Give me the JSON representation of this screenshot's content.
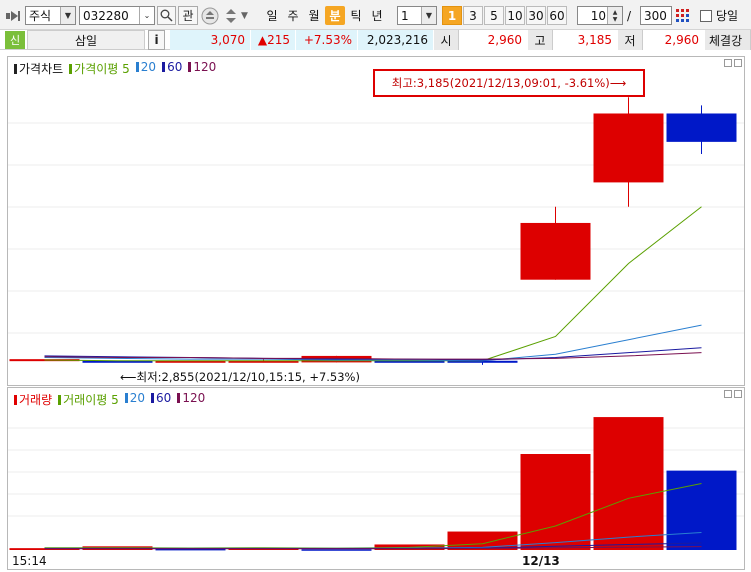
{
  "toolbar": {
    "market": "주식",
    "code": "032280",
    "interest_label": "관",
    "periods": [
      "일",
      "주",
      "월",
      "분",
      "틱",
      "년"
    ],
    "active_period": "분",
    "interval_value": "1",
    "quick_buttons": [
      "1",
      "3",
      "5",
      "10",
      "30",
      "60"
    ],
    "active_quick": "1",
    "count_value": "10",
    "count_sep": "/",
    "count_total": "300",
    "today_label": "당일"
  },
  "info": {
    "badge": "신",
    "name": "삼일",
    "info_button": "i",
    "price": "3,070",
    "change": "▲215",
    "change_pct": "+7.53%",
    "volume": "2,023,216",
    "open_label": "시",
    "open": "2,960",
    "high_label": "고",
    "high": "3,185",
    "low_label": "저",
    "low": "2,960",
    "trade_label": "체결강"
  },
  "price_chart": {
    "legend": [
      {
        "label": "가격차트",
        "color": "#222222"
      },
      {
        "label": "가격이평 5",
        "color": "#5aa000"
      },
      {
        "label": "20",
        "color": "#2a7fd0"
      },
      {
        "label": "60",
        "color": "#1a1aa0"
      },
      {
        "label": "120",
        "color": "#7a1050"
      }
    ],
    "high_annotation": "최고:3,185(2021/12/13,09:01, -3.61%)⟶",
    "low_annotation": "⟵최저:2,855(2021/12/10,15:15, +7.53%)"
  },
  "volume_chart": {
    "legend": [
      {
        "label": "거래량",
        "color": "#e00000"
      },
      {
        "label": "거래이평 5",
        "color": "#5aa000"
      },
      {
        "label": "20",
        "color": "#2a7fd0"
      },
      {
        "label": "60",
        "color": "#1a1aa0"
      },
      {
        "label": "120",
        "color": "#7a1050"
      }
    ]
  },
  "x_axis": {
    "left_label": "15:14",
    "date_label": "12/13"
  },
  "colors": {
    "up": "#dd0000",
    "down": "#0018c8",
    "ma5": "#5aa000",
    "ma20": "#2a7fd0",
    "ma60": "#1a1aa0",
    "ma120": "#7a1050",
    "annotation_box": "#dd0000"
  },
  "chart_data": {
    "type": "candlestick",
    "series": [
      {
        "name": "price",
        "candles": [
          {
            "o": 2862,
            "h": 2862,
            "l": 2862,
            "c": 2862
          },
          {
            "o": 2860,
            "h": 2860,
            "l": 2858,
            "c": 2859
          },
          {
            "o": 2860,
            "h": 2860,
            "l": 2859,
            "c": 2860
          },
          {
            "o": 2860,
            "h": 2862,
            "l": 2858,
            "c": 2860
          },
          {
            "o": 2858,
            "h": 2866,
            "l": 2858,
            "c": 2866
          },
          {
            "o": 2860,
            "h": 2860,
            "l": 2858,
            "c": 2859
          },
          {
            "o": 2860,
            "h": 2860,
            "l": 2855,
            "c": 2858
          },
          {
            "o": 2960,
            "h": 3050,
            "l": 2960,
            "c": 3030
          },
          {
            "o": 3080,
            "h": 3185,
            "l": 3050,
            "c": 3165
          },
          {
            "o": 3165,
            "h": 3175,
            "l": 3115,
            "c": 3130
          }
        ]
      },
      {
        "name": "가격이평 5",
        "values": [
          2861,
          2860,
          2860,
          2860,
          2860,
          2860,
          2860,
          2890,
          2980,
          3050
        ]
      },
      {
        "name": "20",
        "values": [
          2864,
          2863,
          2862,
          2862,
          2861,
          2861,
          2860,
          2868,
          2886,
          2904
        ]
      },
      {
        "name": "60",
        "values": [
          2866,
          2865,
          2864,
          2863,
          2862,
          2862,
          2861,
          2864,
          2870,
          2876
        ]
      },
      {
        "name": "120",
        "values": [
          2865,
          2864,
          2864,
          2863,
          2863,
          2862,
          2862,
          2863,
          2866,
          2870
        ]
      }
    ],
    "volume": {
      "values": [
        10000,
        20000,
        6000,
        9000,
        4000,
        30000,
        100000,
        520000,
        720000,
        430000
      ],
      "directions": [
        "up",
        "up",
        "down",
        "up",
        "down",
        "up",
        "up",
        "up",
        "up",
        "down"
      ],
      "ma5": [
        12000,
        12000,
        11000,
        12000,
        10000,
        14000,
        34000,
        130000,
        280000,
        360000
      ],
      "ma20": [
        9000,
        9000,
        9000,
        9000,
        9000,
        10000,
        14000,
        40000,
        70000,
        95000
      ],
      "ma60": [
        8000,
        8000,
        8000,
        8000,
        8000,
        8000,
        10000,
        20000,
        30000,
        38000
      ],
      "ma120": [
        7000,
        7000,
        7000,
        7000,
        7000,
        7000,
        8000,
        12000,
        15000,
        18000
      ]
    },
    "price_range": [
      2840,
      3210
    ],
    "volume_range": [
      0,
      780000
    ]
  }
}
